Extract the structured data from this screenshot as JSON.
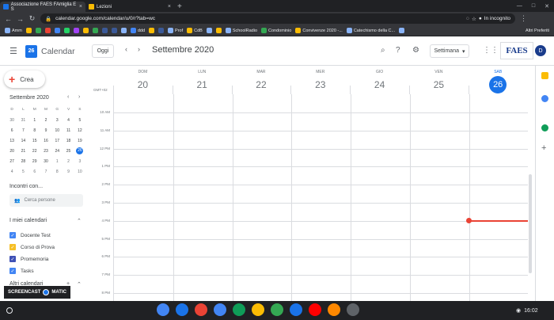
{
  "browser": {
    "tabs": [
      {
        "title": "Associazione FAES FAmiglia E S",
        "active": true
      },
      {
        "title": "Lezioni",
        "active": false
      }
    ],
    "url": "calendar.google.com/calendar/u/0/r?tab=wc",
    "incognito_label": "In incognito",
    "bookmarks": [
      {
        "label": "Amm",
        "color": "#8ab4f8"
      },
      {
        "label": "",
        "color": "#fbbc04"
      },
      {
        "label": "",
        "color": "#34a853"
      },
      {
        "label": "",
        "color": "#ea4335"
      },
      {
        "label": "",
        "color": "#4285f4"
      },
      {
        "label": "",
        "color": "#25d366"
      },
      {
        "label": "",
        "color": "#a142f4"
      },
      {
        "label": "",
        "color": "#fbbc04"
      },
      {
        "label": "",
        "color": "#34a853"
      },
      {
        "label": "",
        "color": "#3b5998"
      },
      {
        "label": "",
        "color": "#3b5998"
      },
      {
        "label": "",
        "color": "#8ab4f8"
      },
      {
        "label": "ddd",
        "color": "#4285f4"
      },
      {
        "label": "",
        "color": "#fbbc04"
      },
      {
        "label": "",
        "color": "#3b5998"
      },
      {
        "label": "Prof",
        "color": "#8ab4f8"
      },
      {
        "label": "CdB",
        "color": "#fbbc04"
      },
      {
        "label": "",
        "color": "#8ab4f8"
      },
      {
        "label": "",
        "color": "#fbbc04"
      },
      {
        "label": "SchoolRadio",
        "color": "#8ab4f8"
      },
      {
        "label": "Condominio",
        "color": "#34a853"
      },
      {
        "label": "Convivenze 2020 -...",
        "color": "#fbbc04"
      },
      {
        "label": "Catechismo della C...",
        "color": "#8ab4f8"
      },
      {
        "label": "",
        "color": "#8ab4f8"
      }
    ],
    "other_bookmarks": "Altri Preferiti"
  },
  "header": {
    "app_name": "Calendar",
    "logo_day": "26",
    "today_button": "Oggi",
    "month_label": "Settembre 2020",
    "view_selector": "Settimana",
    "org_logo": "FAES",
    "avatar_letter": "D"
  },
  "sidebar": {
    "create_label": "Crea",
    "mini_calendar": {
      "title": "Settembre 2020",
      "weekdays": [
        "D",
        "L",
        "M",
        "M",
        "G",
        "V",
        "S"
      ],
      "weeks": [
        [
          "30",
          "31",
          "1",
          "2",
          "3",
          "4",
          "5"
        ],
        [
          "6",
          "7",
          "8",
          "9",
          "10",
          "11",
          "12"
        ],
        [
          "13",
          "14",
          "15",
          "16",
          "17",
          "18",
          "19"
        ],
        [
          "20",
          "21",
          "22",
          "23",
          "24",
          "25",
          "26"
        ],
        [
          "27",
          "28",
          "29",
          "30",
          "1",
          "2",
          "3"
        ],
        [
          "4",
          "5",
          "6",
          "7",
          "8",
          "9",
          "10"
        ]
      ],
      "today": "26"
    },
    "meet_title": "Incontri con...",
    "search_people_placeholder": "Cerca persone",
    "my_calendars_title": "I miei calendari",
    "my_calendars": [
      {
        "name": "Docente Test",
        "color": "#4285f4"
      },
      {
        "name": "Corso di Prova",
        "color": "#f6bf26"
      },
      {
        "name": "Promemoria",
        "color": "#3f51b5"
      },
      {
        "name": "Tasks",
        "color": "#4285f4"
      }
    ],
    "other_calendars_title": "Altri calendari"
  },
  "week": {
    "timezone": "GMT+02",
    "days": [
      {
        "name": "DOM",
        "num": "20"
      },
      {
        "name": "LUN",
        "num": "21"
      },
      {
        "name": "MAR",
        "num": "22"
      },
      {
        "name": "MER",
        "num": "23"
      },
      {
        "name": "GIO",
        "num": "24"
      },
      {
        "name": "VEN",
        "num": "25"
      },
      {
        "name": "SAB",
        "num": "26",
        "today": true
      }
    ],
    "hours": [
      "10 AM",
      "11 AM",
      "12 PM",
      "1 PM",
      "2 PM",
      "3 PM",
      "4 PM",
      "5 PM",
      "6 PM",
      "7 PM",
      "8 PM"
    ]
  },
  "watermark": {
    "left": "SCREENCAST",
    "right": "MATIC"
  },
  "taskbar": {
    "apps": [
      {
        "name": "chrome",
        "color": "#4285f4"
      },
      {
        "name": "files",
        "color": "#1a73e8"
      },
      {
        "name": "gmail",
        "color": "#ea4335"
      },
      {
        "name": "docs",
        "color": "#4285f4"
      },
      {
        "name": "sheets",
        "color": "#0f9d58"
      },
      {
        "name": "photos",
        "color": "#fbbc04"
      },
      {
        "name": "drive",
        "color": "#34a853"
      },
      {
        "name": "contacts",
        "color": "#1a73e8"
      },
      {
        "name": "youtube",
        "color": "#ff0000"
      },
      {
        "name": "vlc",
        "color": "#ff8800"
      },
      {
        "name": "screencast",
        "color": "#5f6368"
      }
    ],
    "clock": "16:02"
  }
}
